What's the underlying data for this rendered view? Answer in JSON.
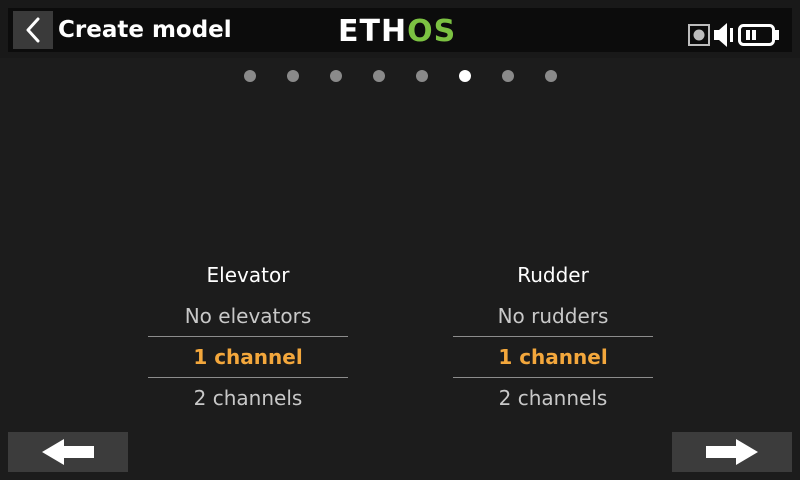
{
  "header": {
    "title": "Create model",
    "logo_part1": "ETH",
    "logo_part2": "OS"
  },
  "pager": {
    "total": 8,
    "active_index": 5
  },
  "elevator": {
    "label": "Elevator",
    "options": [
      "No elevators",
      "1 channel",
      "2 channels"
    ],
    "selected": "1 channel"
  },
  "rudder": {
    "label": "Rudder",
    "options": [
      "No rudders",
      "1 channel",
      "2 channels"
    ],
    "selected": "1 channel"
  },
  "colors": {
    "accent": "#f3a73c",
    "logo_green": "#7cc242",
    "background": "#1c1c1c"
  },
  "icons": {
    "back": "chevron-left-icon",
    "status": [
      "record-square-icon",
      "speaker-icon",
      "battery-icon"
    ],
    "prev": "arrow-left-icon",
    "next": "arrow-right-icon"
  }
}
